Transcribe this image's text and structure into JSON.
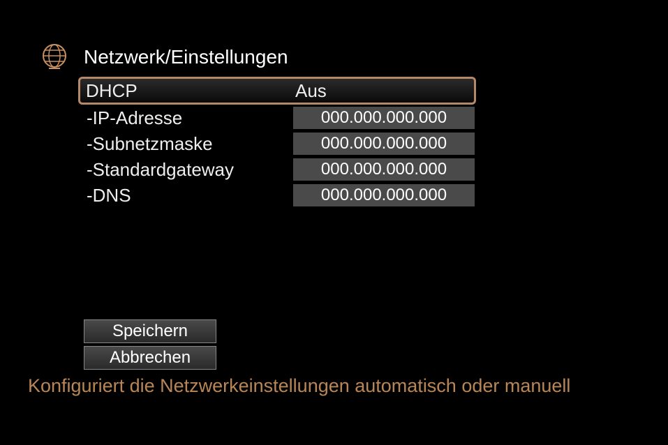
{
  "header": {
    "title": "Netzwerk/Einstellungen"
  },
  "settings": {
    "dhcp": {
      "label": "DHCP",
      "value": "Aus"
    },
    "ip": {
      "label": "-IP-Adresse",
      "value": "000.000.000.000"
    },
    "subnet": {
      "label": "-Subnetzmaske",
      "value": "000.000.000.000"
    },
    "gateway": {
      "label": "-Standardgateway",
      "value": "000.000.000.000"
    },
    "dns": {
      "label": "-DNS",
      "value": "000.000.000.000"
    }
  },
  "buttons": {
    "save": "Speichern",
    "cancel": "Abbrechen"
  },
  "help": "Konfiguriert die Netzwerkeinstellungen automatisch oder manuell"
}
